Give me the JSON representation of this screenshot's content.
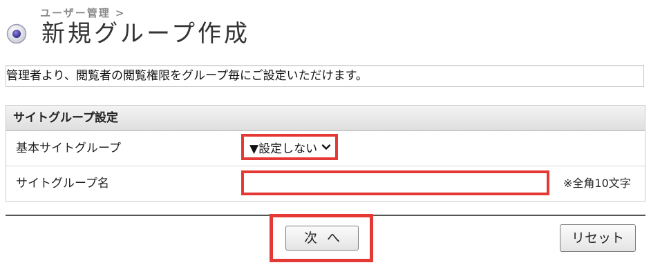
{
  "header": {
    "breadcrumb": "ユーザー管理 >",
    "title": "新規グループ作成",
    "title_icon": "radio-dot-icon"
  },
  "description": "管理者より、閲覧者の閲覧権限をグループ毎にご設定いただけます。",
  "settings": {
    "section_title": "サイトグループ設定",
    "rows": [
      {
        "label": "基本サイトグループ",
        "select_value": "▼設定しない",
        "select_icon": "chevron-down-icon"
      },
      {
        "label": "サイトグループ名",
        "input_value": "",
        "input_placeholder": "",
        "note": "※全角10文字"
      }
    ]
  },
  "actions": {
    "next_label": "次へ",
    "reset_label": "リセット"
  },
  "colors": {
    "highlight": "#e53935",
    "icon_fill": "#3a2f8f"
  }
}
